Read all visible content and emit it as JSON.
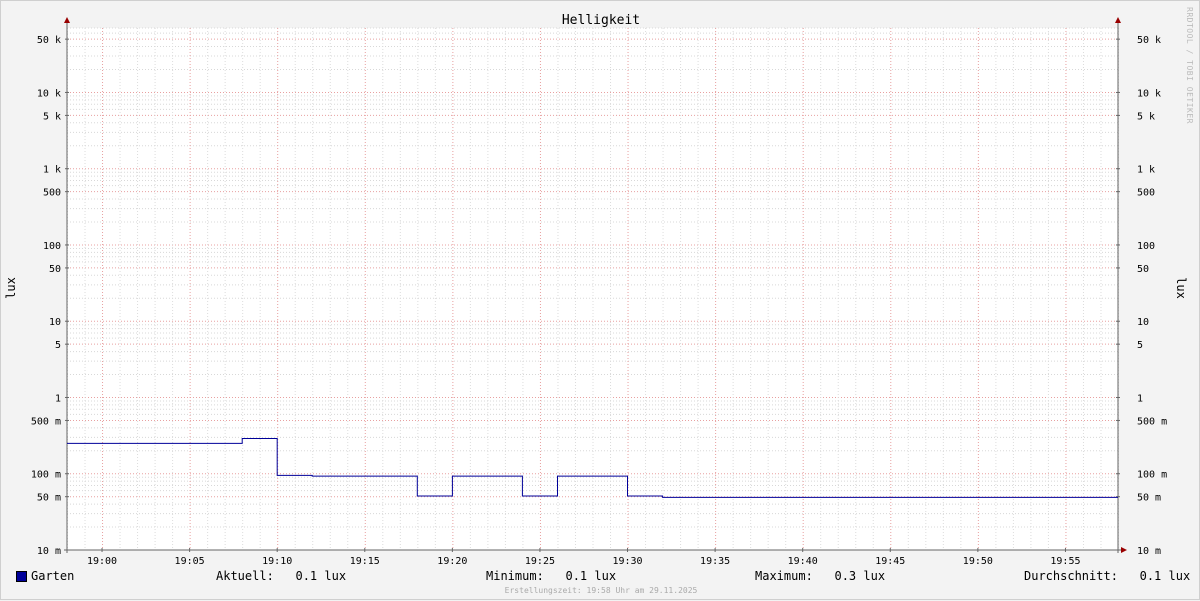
{
  "chart_data": {
    "type": "line",
    "title": "Helligkeit",
    "ylabel": "lux",
    "yscale": "log",
    "ylim": [
      0.01,
      70000
    ],
    "y_ticks": [
      {
        "value": 50000,
        "label": "50 k"
      },
      {
        "value": 10000,
        "label": "10 k"
      },
      {
        "value": 5000,
        "label": "5 k"
      },
      {
        "value": 1000,
        "label": "1 k"
      },
      {
        "value": 500,
        "label": "500"
      },
      {
        "value": 100,
        "label": "100"
      },
      {
        "value": 50,
        "label": "50"
      },
      {
        "value": 10,
        "label": "10"
      },
      {
        "value": 5,
        "label": "5"
      },
      {
        "value": 1,
        "label": "1"
      },
      {
        "value": 0.5,
        "label": "500 m"
      },
      {
        "value": 0.1,
        "label": "100 m"
      },
      {
        "value": 0.05,
        "label": "50 m"
      },
      {
        "value": 0.01,
        "label": "10 m"
      }
    ],
    "xlim": [
      "18:58",
      "19:58"
    ],
    "x_ticks": [
      "19:00",
      "19:05",
      "19:10",
      "19:15",
      "19:20",
      "19:25",
      "19:30",
      "19:35",
      "19:40",
      "19:45",
      "19:50",
      "19:55"
    ],
    "grid": true,
    "series": [
      {
        "name": "Garten",
        "color": "#000099",
        "points": [
          [
            "18:58",
            0.25
          ],
          [
            "19:08",
            0.25
          ],
          [
            "19:08",
            0.29
          ],
          [
            "19:10",
            0.29
          ],
          [
            "19:10",
            0.095
          ],
          [
            "19:12",
            0.095
          ],
          [
            "19:12",
            0.093
          ],
          [
            "19:18",
            0.093
          ],
          [
            "19:18",
            0.051
          ],
          [
            "19:20",
            0.051
          ],
          [
            "19:20",
            0.093
          ],
          [
            "19:24",
            0.093
          ],
          [
            "19:24",
            0.051
          ],
          [
            "19:26",
            0.051
          ],
          [
            "19:26",
            0.093
          ],
          [
            "19:30",
            0.093
          ],
          [
            "19:30",
            0.051
          ],
          [
            "19:32",
            0.051
          ],
          [
            "19:32",
            0.049
          ],
          [
            "19:58",
            0.049
          ]
        ]
      }
    ]
  },
  "legend": {
    "series_name": "Garten",
    "swatch_color": "#000099",
    "current": "Aktuell:   0.1 lux",
    "minimum": "Minimum:   0.1 lux",
    "maximum": "Maximum:   0.3 lux",
    "average": "Durchschnitt:   0.1 lux"
  },
  "footer": "Erstellungszeit: 19:58 Uhr am 29.11.2025",
  "watermark": "RRDTOOL / TOBI OETIKER"
}
